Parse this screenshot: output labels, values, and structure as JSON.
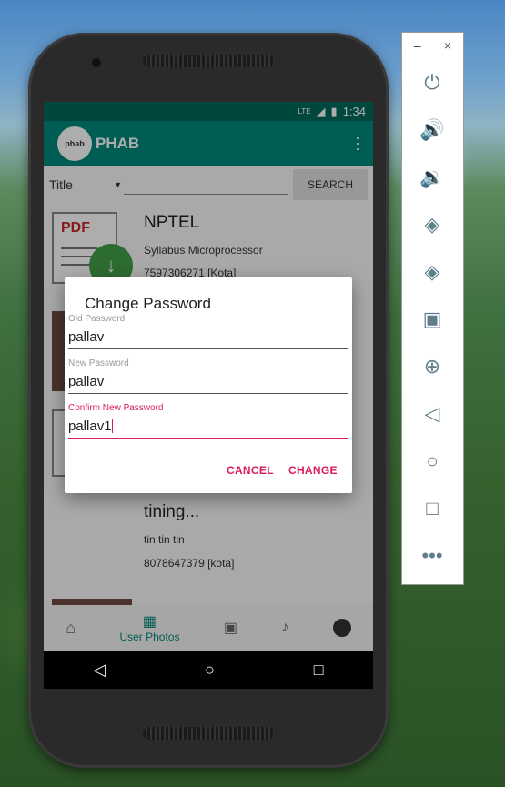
{
  "status_bar": {
    "network": "LTE",
    "time": "1:34"
  },
  "app_bar": {
    "logo_text": "phab",
    "title": "PHAB"
  },
  "search": {
    "selected_option": "Title",
    "button_label": "SEARCH"
  },
  "cards": [
    {
      "title": "NPTEL",
      "subtitle": "Syllabus Microprocessor",
      "contact": "7597306271 [Kota]",
      "icon_label": "PDF"
    },
    {
      "title": "tining...",
      "subtitle": "tin tin tin",
      "contact": "8078647379 [kota]"
    }
  ],
  "bottom_nav": {
    "active_label": "User Photos"
  },
  "dialog": {
    "title": "Change Password",
    "fields": [
      {
        "label": "Old Password",
        "value": "pallav"
      },
      {
        "label": "New Password",
        "value": "pallav"
      },
      {
        "label": "Confirm New Password",
        "value": "pallav1"
      }
    ],
    "cancel_label": "CANCEL",
    "confirm_label": "CHANGE"
  },
  "colors": {
    "primary": "#00897b",
    "primary_dark": "#00695c",
    "accent": "#d81b60"
  }
}
